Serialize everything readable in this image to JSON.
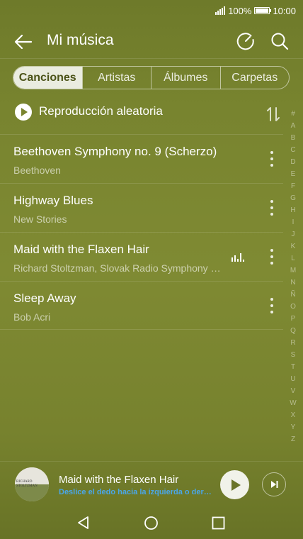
{
  "status_bar": {
    "battery_text": "100%",
    "time": "10:00"
  },
  "app_bar": {
    "title": "Mi música",
    "back_icon": "arrow-left-icon",
    "sleep_timer_icon": "timer-icon",
    "search_icon": "search-icon"
  },
  "tabs": [
    {
      "label": "Canciones",
      "active": true
    },
    {
      "label": "Artistas",
      "active": false
    },
    {
      "label": "Álbumes",
      "active": false
    },
    {
      "label": "Carpetas",
      "active": false
    }
  ],
  "shuffle": {
    "label": "Reproducción aleatoria",
    "icon": "play-circle-icon",
    "sort_icon": "sort-icon"
  },
  "songs": [
    {
      "title": "Beethoven Symphony no. 9 (Scherzo)",
      "artist": "Beethoven",
      "playing": false
    },
    {
      "title": "Highway Blues",
      "artist": "New Stories",
      "playing": false
    },
    {
      "title": "Maid with the Flaxen Hair",
      "artist": "Richard Stoltzman, Slovak Radio Symphony Orchestra",
      "playing": true
    },
    {
      "title": "Sleep Away",
      "artist": "Bob Acri",
      "playing": false
    }
  ],
  "alphabet_index": [
    "#",
    "A",
    "B",
    "C",
    "D",
    "E",
    "F",
    "G",
    "H",
    "I",
    "J",
    "K",
    "L",
    "M",
    "N",
    "Ñ",
    "O",
    "P",
    "Q",
    "R",
    "S",
    "T",
    "U",
    "V",
    "W",
    "X",
    "Y",
    "Z"
  ],
  "now_playing": {
    "title": "Maid with the Flaxen Hair",
    "hint": "Deslice el dedo hacia la izquierda o derecha para cambiar de canción",
    "album_art_text": "RICHARD STOLTZMAN",
    "hint_color": "#4aa6e8"
  },
  "nav_bar": {
    "back_icon": "nav-back-icon",
    "home_icon": "nav-home-icon",
    "recents_icon": "nav-recents-icon"
  },
  "colors": {
    "background": "#7a852f",
    "active_tab_text": "#4b5318"
  }
}
